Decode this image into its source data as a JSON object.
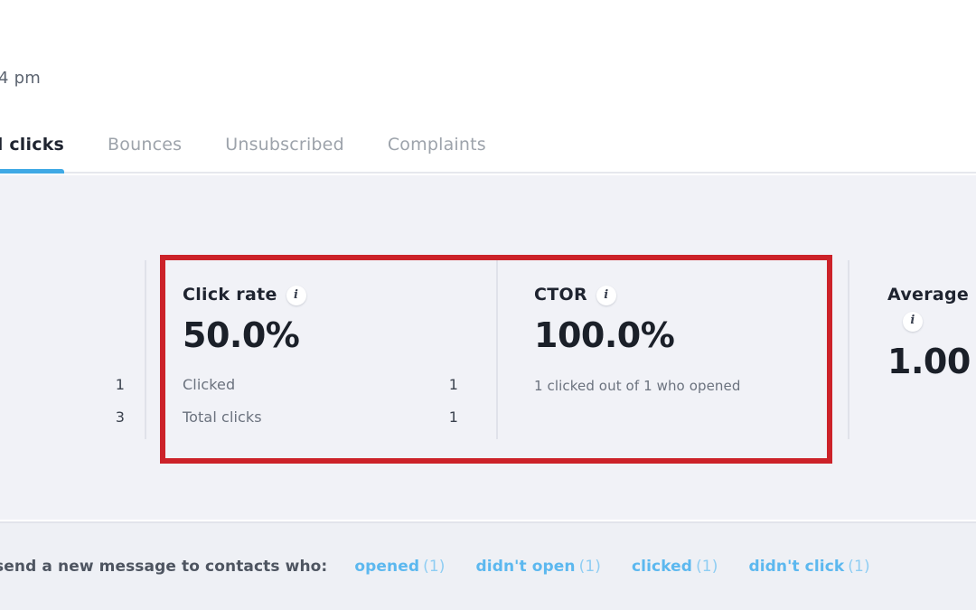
{
  "header": {
    "timestamp": "4 pm"
  },
  "tabs": [
    {
      "label": "nd clicks",
      "active": true
    },
    {
      "label": "Bounces",
      "active": false
    },
    {
      "label": "Unsubscribed",
      "active": false
    },
    {
      "label": "Complaints",
      "active": false
    }
  ],
  "cards": {
    "partial_left": {
      "rows": [
        {
          "label": "",
          "value": "1"
        },
        {
          "label": "",
          "value": "3"
        }
      ]
    },
    "click_rate": {
      "title": "Click rate",
      "info_icon": "info-icon",
      "value": "50.0%",
      "rows": [
        {
          "label": "Clicked",
          "value": "1"
        },
        {
          "label": "Total clicks",
          "value": "1"
        }
      ]
    },
    "ctor": {
      "title": "CTOR",
      "info_icon": "info-icon",
      "value": "100.0%",
      "note": "1 clicked out of 1 who opened"
    },
    "average": {
      "title": "Average",
      "info_icon": "info-icon",
      "value": "1.00"
    }
  },
  "bottom": {
    "label": "and send a new message to contacts who:",
    "links": [
      {
        "text": "opened",
        "count": "(1)"
      },
      {
        "text": "didn't open",
        "count": "(1)"
      },
      {
        "text": "clicked",
        "count": "(1)"
      },
      {
        "text": "didn't click",
        "count": "(1)"
      }
    ]
  },
  "colors": {
    "accent_blue": "#3fa9e5",
    "link_blue": "#5cb8ef",
    "annotation_red": "#cc2229",
    "band_background": "#f1f2f7",
    "bottom_background": "#eef0f5"
  }
}
